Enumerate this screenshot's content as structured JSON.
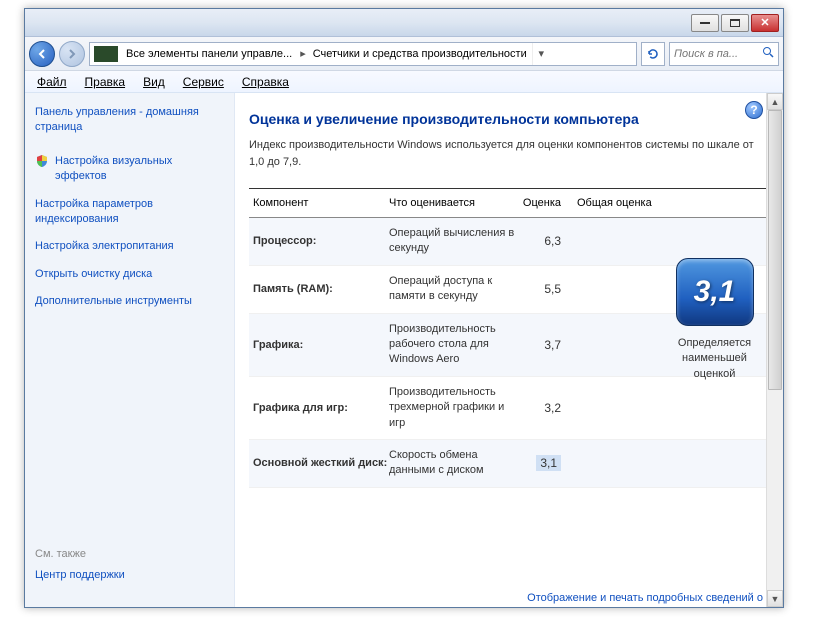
{
  "address": {
    "seg1": "Все элементы панели управле...",
    "seg2": "Счетчики и средства производительности"
  },
  "search": {
    "placeholder": "Поиск в па..."
  },
  "menu": {
    "file": "Файл",
    "edit": "Правка",
    "view": "Вид",
    "service": "Сервис",
    "help": "Справка"
  },
  "sidebar": {
    "home": "Панель управления - домашняя страница",
    "links": [
      "Настройка визуальных эффектов",
      "Настройка параметров индексирования",
      "Настройка электропитания",
      "Открыть очистку диска",
      "Дополнительные инструменты"
    ],
    "also": "См. также",
    "support": "Центр поддержки"
  },
  "content": {
    "title": "Оценка и увеличение производительности компьютера",
    "desc": "Индекс производительности Windows используется для оценки компонентов системы по шкале от 1,0 до 7,9.",
    "head": {
      "c1": "Компонент",
      "c2": "Что оценивается",
      "c3": "Оценка",
      "c4": "Общая оценка"
    },
    "rows": [
      {
        "name": "Процессор:",
        "what": "Операций вычисления в секунду",
        "score": "6,3"
      },
      {
        "name": "Память (RAM):",
        "what": "Операций доступа к памяти в секунду",
        "score": "5,5"
      },
      {
        "name": "Графика:",
        "what": "Производительность рабочего стола для Windows Aero",
        "score": "3,7"
      },
      {
        "name": "Графика для игр:",
        "what": "Производительность трехмерной графики и игр",
        "score": "3,2"
      },
      {
        "name": "Основной жесткий диск:",
        "what": "Скорость обмена данными с диском",
        "score": "3,1"
      }
    ],
    "overall": {
      "score": "3,1",
      "label": "Определяется наименьшей оценкой"
    },
    "footer": "Отображение и печать подробных сведений о"
  }
}
